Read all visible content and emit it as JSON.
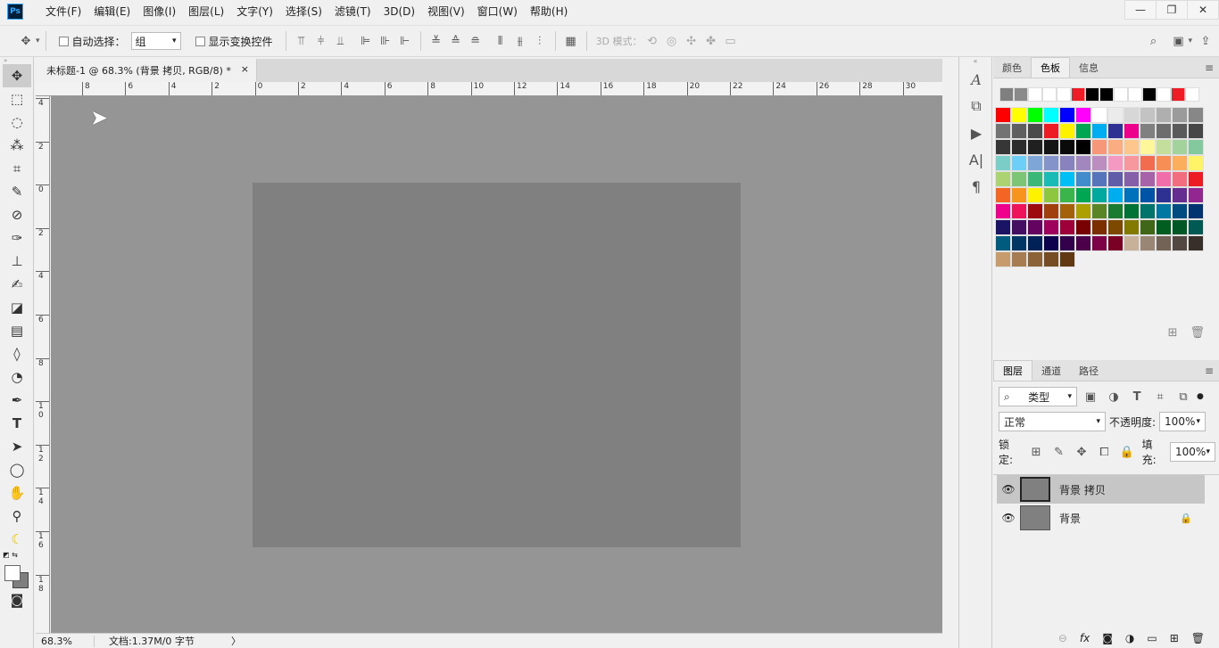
{
  "app": {
    "logo": "Ps"
  },
  "menus": [
    "文件(F)",
    "编辑(E)",
    "图像(I)",
    "图层(L)",
    "文字(Y)",
    "选择(S)",
    "滤镜(T)",
    "3D(D)",
    "视图(V)",
    "窗口(W)",
    "帮助(H)"
  ],
  "window_controls": {
    "minimize": "—",
    "restore": "❐",
    "close": "✕"
  },
  "options": {
    "auto_select_label": "自动选择：",
    "auto_select_value": "组",
    "show_transform_label": "显示变换控件",
    "mode3d_label": "3D 模式："
  },
  "document": {
    "tab_title": "未标题-1 @ 68.3% (背景 拷贝, RGB/8) *",
    "close": "×"
  },
  "rulers": {
    "top": [
      "8",
      "6",
      "4",
      "2",
      "0",
      "2",
      "4",
      "6",
      "8",
      "10",
      "12",
      "14",
      "16",
      "18",
      "20",
      "22",
      "24",
      "26",
      "28",
      "30"
    ],
    "left": [
      "4",
      "2",
      "0",
      "2",
      "4",
      "6",
      "8",
      "1 0",
      "1 2",
      "1 4",
      "1 6",
      "1 8"
    ]
  },
  "status": {
    "zoom": "68.3%",
    "doc": "文档:1.37M/0 字节",
    "arrow": "〉"
  },
  "swatch_panel": {
    "tabs": [
      "颜色",
      "色板",
      "信息"
    ],
    "active_tab": "色板",
    "recent": [
      "#7f7f7f",
      "#8a8a8a",
      "#ffffff",
      "#ffffff",
      "#ffffff",
      "#ee1c24",
      "#000000",
      "#000000",
      "#ffffff",
      "#ffffff",
      "#000000",
      "#ffffff",
      "#ee1c24",
      "#ffffff"
    ],
    "swatches": [
      "#ff0000",
      "#ffff00",
      "#00ff00",
      "#00ffff",
      "#0000ff",
      "#ff00ff",
      "#ffffff",
      "#ebebeb",
      "#d7d7d7",
      "#c3c3c3",
      "#afafaf",
      "#9b9b9b",
      "#878787",
      "#737373",
      "#5f5f5f",
      "#4b4b4b",
      "#ed1c24",
      "#fff200",
      "#00a651",
      "#00aeef",
      "#2e3192",
      "#ec008c",
      "#808080",
      "#6d6d6d",
      "#5a5a5a",
      "#474747",
      "#363636",
      "#2b2b2b",
      "#202020",
      "#151515",
      "#0a0a0a",
      "#000000",
      "#f7977a",
      "#f9ad81",
      "#fdc68a",
      "#fff79a",
      "#c4df9b",
      "#a3d39c",
      "#82ca9d",
      "#7bcdc8",
      "#6ecff6",
      "#7ea7d8",
      "#8493ca",
      "#8882be",
      "#a187be",
      "#bc8dbf",
      "#f49ac2",
      "#f6989d",
      "#f26c4f",
      "#f68e55",
      "#fbaf5c",
      "#fff467",
      "#acd372",
      "#7cc576",
      "#3bb878",
      "#1abbb4",
      "#00bff3",
      "#438ccb",
      "#5574b9",
      "#605ca8",
      "#855fa8",
      "#a763a8",
      "#f06ea9",
      "#f26d7d",
      "#ed1c24",
      "#f26522",
      "#f7941d",
      "#fff200",
      "#8dc63f",
      "#39b54a",
      "#00a651",
      "#00a99d",
      "#00aeef",
      "#0072bc",
      "#0054a6",
      "#2e3192",
      "#662d91",
      "#92278f",
      "#ec008c",
      "#ed145b",
      "#9e0b0f",
      "#a0410d",
      "#a3620a",
      "#aba000",
      "#598527",
      "#197b30",
      "#007236",
      "#00746b",
      "#0076a3",
      "#004b80",
      "#003471",
      "#1b1464",
      "#440e62",
      "#630460",
      "#9e005d",
      "#9e0039",
      "#790000",
      "#7b2e00",
      "#7d4900",
      "#827b00",
      "#406618",
      "#005e20",
      "#005826",
      "#005952",
      "#005b7f",
      "#003663",
      "#002157",
      "#0d004c",
      "#32004b",
      "#4b0049",
      "#7b0046",
      "#7a0026",
      "#c7b299",
      "#998675",
      "#736357",
      "#534741",
      "#37302a",
      "#c69c6d",
      "#a67c52",
      "#8c6239",
      "#754c24",
      "#603913"
    ]
  },
  "layers_panel": {
    "tabs": [
      "图层",
      "通道",
      "路径"
    ],
    "active_tab": "图层",
    "filter_label": "类型",
    "blend_mode": "正常",
    "opacity_label": "不透明度:",
    "opacity_value": "100%",
    "lock_label": "锁定:",
    "fill_label": "填充:",
    "fill_value": "100%",
    "layers": [
      {
        "name": "背景 拷贝",
        "selected": true,
        "locked": false
      },
      {
        "name": "背景",
        "selected": false,
        "locked": true
      }
    ]
  }
}
